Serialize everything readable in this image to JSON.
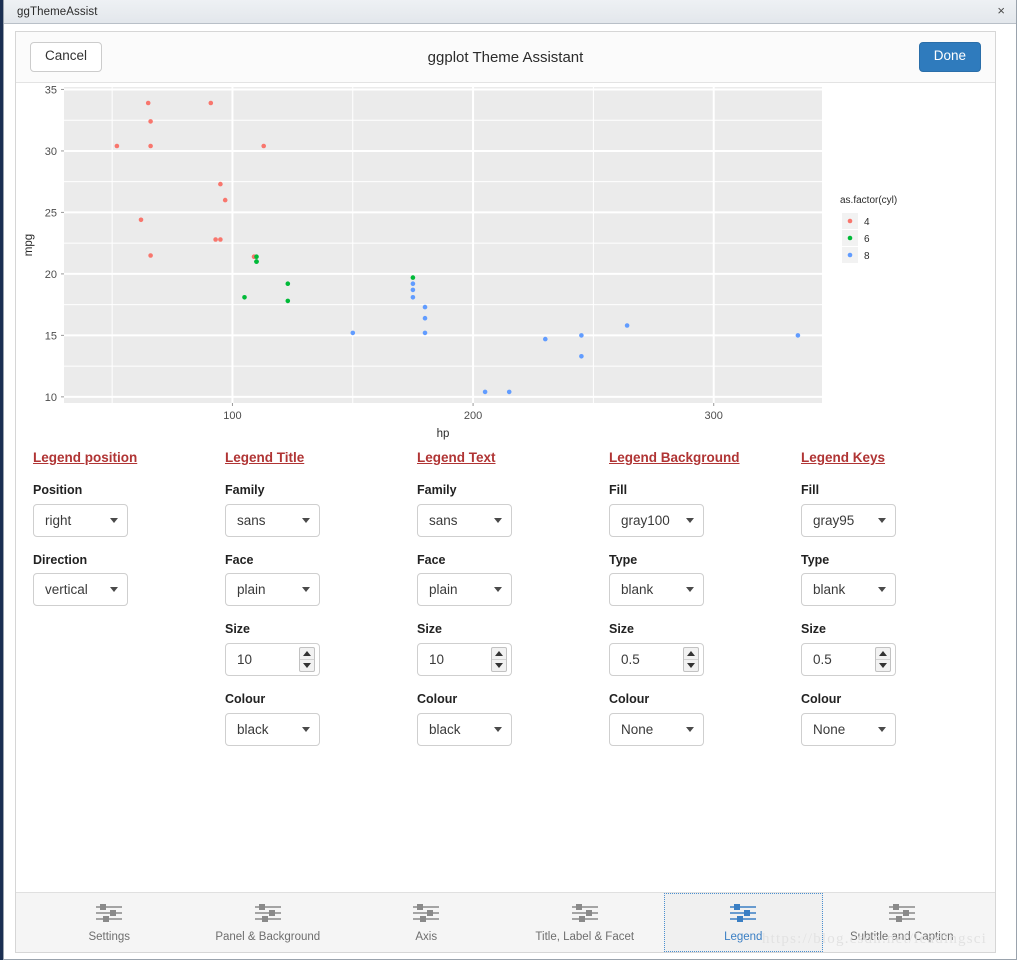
{
  "window": {
    "title": "ggThemeAssist",
    "close_label": "×"
  },
  "header": {
    "cancel_label": "Cancel",
    "title": "ggplot Theme Assistant",
    "done_label": "Done"
  },
  "watermark": "https://blog.csdn.net/leadingsci",
  "colors": {
    "section_heading": "#b03434",
    "accent_blue": "#3b7fc4",
    "done_button": "#2f7bbd",
    "panel_fill": "#ebebeb",
    "grid": "#ffffff",
    "cyl4": "#f8766d",
    "cyl6": "#00ba38",
    "cyl8": "#619cff"
  },
  "chart_data": {
    "type": "scatter",
    "title": "",
    "xlabel": "hp",
    "ylabel": "mpg",
    "xlim": [
      30,
      345
    ],
    "ylim": [
      9.5,
      35.2
    ],
    "xticks": [
      100,
      200,
      300
    ],
    "yticks": [
      10,
      15,
      20,
      25,
      30,
      35
    ],
    "xticks_minor": [
      50,
      150,
      250
    ],
    "yticks_minor": [
      12.5,
      17.5,
      22.5,
      27.5,
      32.5
    ],
    "grid": true,
    "legend": {
      "title": "as.factor(cyl)",
      "position": "right",
      "entries": [
        {
          "label": "4",
          "color": "#f8766d"
        },
        {
          "label": "6",
          "color": "#00ba38"
        },
        {
          "label": "8",
          "color": "#619cff"
        }
      ]
    },
    "series": [
      {
        "name": "4",
        "color": "#f8766d",
        "points": [
          [
            66,
            30.4
          ],
          [
            52,
            30.4
          ],
          [
            65,
            33.9
          ],
          [
            66,
            32.4
          ],
          [
            91,
            33.9
          ],
          [
            95,
            27.3
          ],
          [
            97,
            26.0
          ],
          [
            109,
            21.4
          ],
          [
            113,
            30.4
          ],
          [
            62,
            24.4
          ],
          [
            93,
            22.8
          ],
          [
            95,
            22.8
          ],
          [
            66,
            21.5
          ],
          [
            109,
            21.4
          ]
        ]
      },
      {
        "name": "6",
        "color": "#00ba38",
        "points": [
          [
            110,
            21.0
          ],
          [
            110,
            21.0
          ],
          [
            110,
            21.4
          ],
          [
            105,
            18.1
          ],
          [
            123,
            19.2
          ],
          [
            123,
            17.8
          ],
          [
            175,
            19.7
          ]
        ]
      },
      {
        "name": "8",
        "color": "#619cff",
        "points": [
          [
            175,
            18.7
          ],
          [
            180,
            16.4
          ],
          [
            180,
            17.3
          ],
          [
            180,
            15.2
          ],
          [
            205,
            10.4
          ],
          [
            215,
            10.4
          ],
          [
            230,
            14.7
          ],
          [
            245,
            13.3
          ],
          [
            245,
            15.0
          ],
          [
            150,
            15.2
          ],
          [
            175,
            19.2
          ],
          [
            264,
            15.8
          ],
          [
            335,
            15.0
          ],
          [
            175,
            18.1
          ]
        ]
      }
    ]
  },
  "sections": [
    {
      "heading": "Legend position",
      "fields": [
        {
          "label": "Position",
          "kind": "select",
          "value": "right"
        },
        {
          "label": "Direction",
          "kind": "select",
          "value": "vertical"
        }
      ]
    },
    {
      "heading": "Legend Title",
      "fields": [
        {
          "label": "Family",
          "kind": "select",
          "value": "sans"
        },
        {
          "label": "Face",
          "kind": "select",
          "value": "plain"
        },
        {
          "label": "Size",
          "kind": "spinner",
          "value": "10"
        },
        {
          "label": "Colour",
          "kind": "select",
          "value": "black"
        }
      ]
    },
    {
      "heading": "Legend Text",
      "fields": [
        {
          "label": "Family",
          "kind": "select",
          "value": "sans"
        },
        {
          "label": "Face",
          "kind": "select",
          "value": "plain"
        },
        {
          "label": "Size",
          "kind": "spinner",
          "value": "10"
        },
        {
          "label": "Colour",
          "kind": "select",
          "value": "black"
        }
      ]
    },
    {
      "heading": "Legend Background",
      "fields": [
        {
          "label": "Fill",
          "kind": "select",
          "value": "gray100"
        },
        {
          "label": "Type",
          "kind": "select",
          "value": "blank"
        },
        {
          "label": "Size",
          "kind": "spinner",
          "value": "0.5"
        },
        {
          "label": "Colour",
          "kind": "select",
          "value": "None"
        }
      ]
    },
    {
      "heading": "Legend Keys",
      "fields": [
        {
          "label": "Fill",
          "kind": "select",
          "value": "gray95"
        },
        {
          "label": "Type",
          "kind": "select",
          "value": "blank"
        },
        {
          "label": "Size",
          "kind": "spinner",
          "value": "0.5"
        },
        {
          "label": "Colour",
          "kind": "select",
          "value": "None"
        }
      ]
    }
  ],
  "nav": {
    "active_index": 4,
    "items": [
      {
        "label": "Settings",
        "icon": "sliders-icon"
      },
      {
        "label": "Panel & Background",
        "icon": "sliders-icon"
      },
      {
        "label": "Axis",
        "icon": "sliders-icon"
      },
      {
        "label": "Title, Label & Facet",
        "icon": "sliders-icon"
      },
      {
        "label": "Legend",
        "icon": "sliders-icon"
      },
      {
        "label": "Subtitle and Caption",
        "icon": "sliders-icon"
      }
    ]
  }
}
